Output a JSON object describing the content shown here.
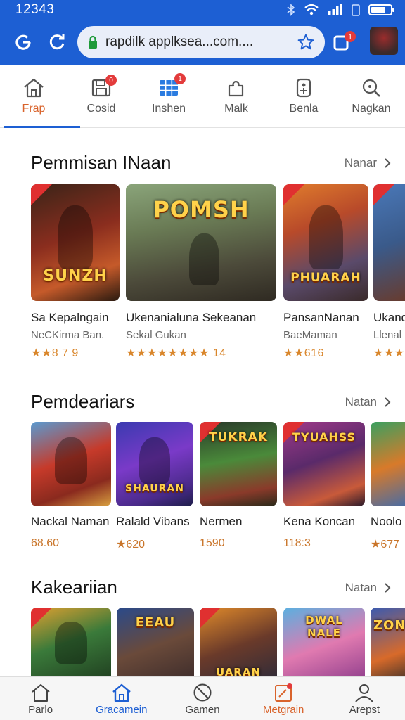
{
  "status_bar": {
    "time": "12343"
  },
  "browser": {
    "url": "rapdilk applksea...com...."
  },
  "categories": [
    {
      "label": "Frap",
      "badge": ""
    },
    {
      "label": "Cosid",
      "badge": "0"
    },
    {
      "label": "Inshen",
      "badge": "1"
    },
    {
      "label": "Malk",
      "badge": ""
    },
    {
      "label": "Benla",
      "badge": ""
    },
    {
      "label": "Nagkan",
      "badge": ""
    }
  ],
  "sections": [
    {
      "title": "Pemmisan INaan",
      "more": "Nanar",
      "items": [
        {
          "logo": "SUNZH",
          "title": "Sa Kepalngain",
          "sub": "NeCKirma Ban.",
          "rating": "★★8 7 9"
        },
        {
          "logo": "POMSH",
          "title": "Ukenanialuna Sekeanan",
          "sub": "Sekal Gukan",
          "rating": "★★★★★★★★ 14"
        },
        {
          "logo": "PHUARAH",
          "title": "PansanNanan",
          "sub": "BaeMaman",
          "rating": "★★616"
        },
        {
          "logo": "",
          "title": "Ukand",
          "sub": "Llenal",
          "rating": "★★★"
        }
      ]
    },
    {
      "title": "Pemdeariars",
      "more": "Natan",
      "items": [
        {
          "logo": "",
          "title": "Nackal Naman",
          "price": "68.60"
        },
        {
          "logo": "SHAURAN",
          "title": "Ralald Vibans",
          "price": "★620"
        },
        {
          "logo": "TUKRAK",
          "title": "Nermen",
          "price": "1590"
        },
        {
          "logo": "TYUAHSS",
          "title": "Kena Koncan",
          "price": "118:3"
        },
        {
          "logo": "",
          "title": "Noolo",
          "price": "★677"
        }
      ]
    },
    {
      "title": "Kakeariian",
      "more": "Natan",
      "items": [
        {
          "logo": ""
        },
        {
          "logo": "EEAU"
        },
        {
          "logo": "UARAN"
        },
        {
          "logo": "DWAL NALE"
        },
        {
          "logo": "ZON"
        }
      ]
    }
  ],
  "bottom_nav": [
    {
      "label": "Parlo"
    },
    {
      "label": "Gracamein"
    },
    {
      "label": "Gamen"
    },
    {
      "label": "Metgrain"
    },
    {
      "label": "Arepst"
    }
  ]
}
